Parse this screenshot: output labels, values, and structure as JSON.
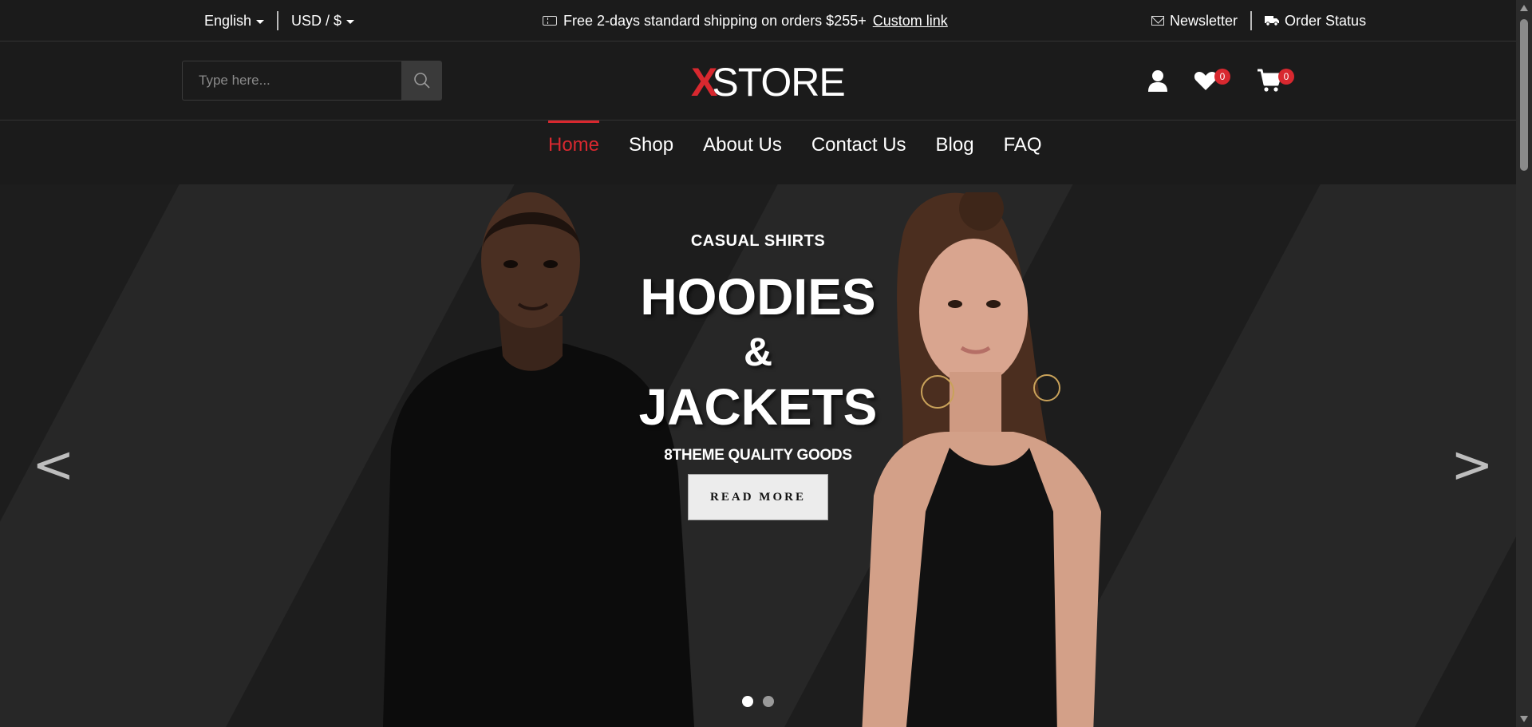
{
  "topbar": {
    "language": "English",
    "currency": "USD / $",
    "promo_text": "Free 2-days standard shipping on orders $255+",
    "promo_link": "Custom link",
    "newsletter": "Newsletter",
    "order_status": "Order Status"
  },
  "header": {
    "search_placeholder": "Type here...",
    "logo_x": "X",
    "logo_store": "STORE",
    "wishlist_count": "0",
    "cart_count": "0"
  },
  "nav": {
    "items": [
      "Home",
      "Shop",
      "About Us",
      "Contact Us",
      "Blog",
      "FAQ"
    ],
    "active_index": 0
  },
  "hero": {
    "eyebrow": "CASUAL SHIRTS",
    "line1": "HOODIES",
    "line2": "&",
    "line3": "JACKETS",
    "tagline": "8THEME QUALITY GOODS",
    "cta": "READ MORE",
    "prev_arrow": "<",
    "next_arrow": ">",
    "slide_count": 2,
    "active_slide": 0
  },
  "colors": {
    "accent": "#d8282f",
    "background": "#1c1c1c",
    "stripe": "#272727"
  }
}
